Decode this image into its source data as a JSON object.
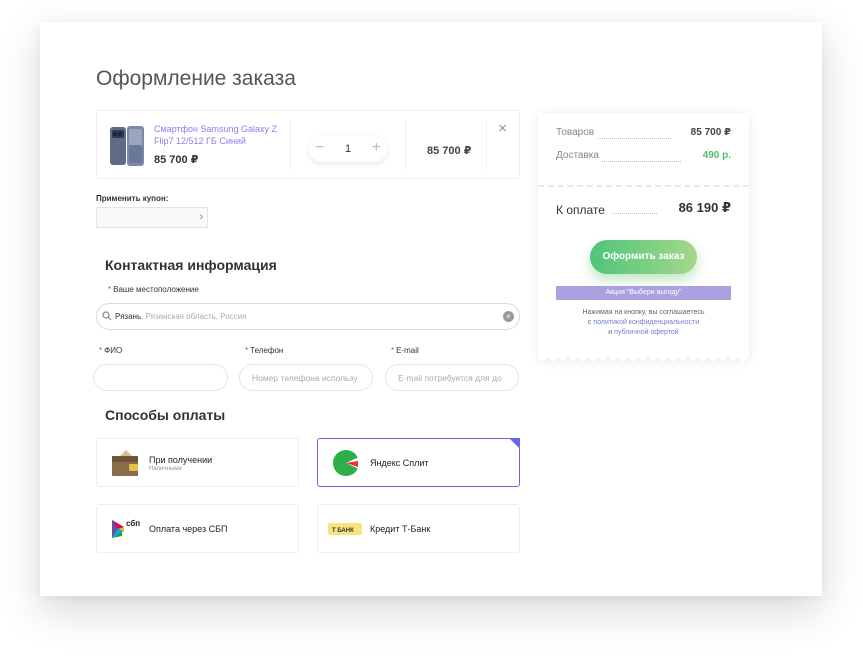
{
  "page_title": "Оформление заказа",
  "cart": {
    "item_name": "Смартфон Samsung Galaxy Z Flip7 12/512 ГБ Синий",
    "item_price": "85 700 ₽",
    "quantity": "1",
    "minus": "−",
    "plus": "+",
    "line_total": "85 700 ₽",
    "remove": "×"
  },
  "coupon": {
    "label": "Применить купон:",
    "value": "",
    "submit": "›"
  },
  "contact": {
    "heading": "Контактная информация",
    "required_mark": "*",
    "location_label": "Ваше местоположение",
    "location_city": "Рязань",
    "location_region": ", Рязанская область, Россия",
    "location_clear": "×",
    "fio_label": "ФИО",
    "fio_placeholder": "",
    "phone_label": "Телефон",
    "phone_placeholder": "Номер телефона использу",
    "email_label": "E-mail",
    "email_placeholder": "E-mail потребуется для до"
  },
  "payment": {
    "heading": "Способы оплаты",
    "methods": [
      {
        "label": "При получении",
        "sublabel": "Наличными",
        "icon": "wallet-icon"
      },
      {
        "label": "Яндекс Сплит",
        "sublabel": "",
        "icon": "yandex-split-icon",
        "selected": true
      },
      {
        "label": "Оплата через СБП",
        "sublabel": "",
        "icon": "sbp-icon"
      },
      {
        "label": "Кредит Т-Банк",
        "sublabel": "",
        "icon": "tbank-icon",
        "icon_text": "Т БАНК"
      }
    ],
    "sbp_icon_text": "сбп"
  },
  "summary": {
    "goods_label": "Товаров",
    "goods_value": "85 700 ₽",
    "delivery_label": "Доставка",
    "delivery_value": "490 р.",
    "total_label": "К оплате",
    "total_value": "86 190 ₽",
    "order_button": "Оформить заказ",
    "promo": "Акция \"Выбери выгоду\"",
    "terms_prefix": "Нажимая на кнопку, вы соглашаетесь",
    "terms_c": "с",
    "privacy_link": "политикой конфиденциальности",
    "terms_and": "и",
    "offer_link": "публичной офертой"
  },
  "colors": {
    "accent": "#8b7df0",
    "selected_border": "#6666e8",
    "green": "#4cbd6e",
    "required": "#e53935"
  }
}
